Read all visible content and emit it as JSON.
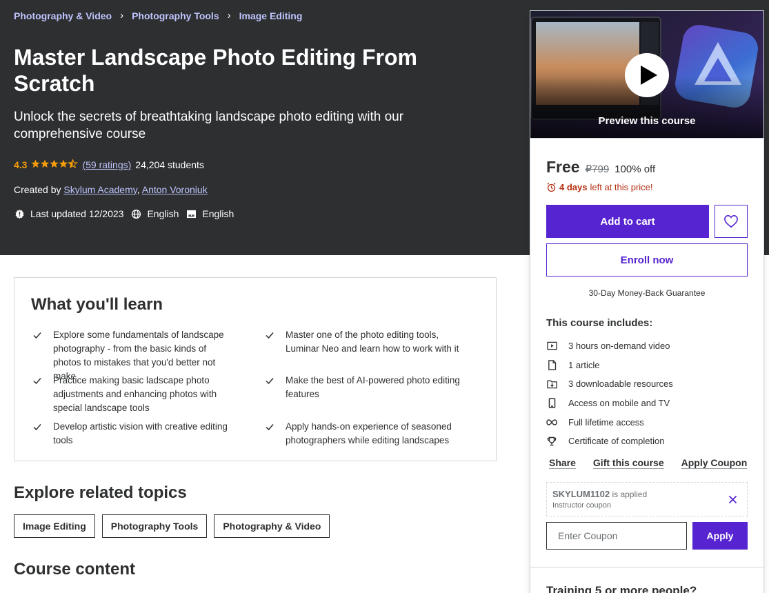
{
  "breadcrumb": [
    {
      "label": "Photography & Video"
    },
    {
      "label": "Photography Tools"
    },
    {
      "label": "Image Editing"
    }
  ],
  "course": {
    "title": "Master Landscape Photo Editing From Scratch",
    "subtitle": "Unlock the secrets of breathtaking landscape photo editing with our comprehensive course",
    "rating": "4.3",
    "rating_stars": 4.3,
    "ratings_link": "(59 ratings)",
    "students": "24,204 students",
    "created_by_label": "Created by",
    "instructors": [
      "Skylum Academy",
      "Anton Voroniuk"
    ],
    "last_updated": "Last updated 12/2023",
    "language": "English",
    "captions": "English"
  },
  "sidebar": {
    "preview_label": "Preview this course",
    "price_current": "Free",
    "price_original": "₽799",
    "discount": "100% off",
    "timer_bold": "4 days",
    "timer_rest": "left at this price!",
    "add_to_cart": "Add to cart",
    "enroll": "Enroll now",
    "guarantee": "30-Day Money-Back Guarantee",
    "includes_title": "This course includes:",
    "includes": [
      {
        "icon": "video-icon",
        "label": "3 hours on-demand video"
      },
      {
        "icon": "article-icon",
        "label": "1 article"
      },
      {
        "icon": "download-icon",
        "label": "3 downloadable resources"
      },
      {
        "icon": "mobile-icon",
        "label": "Access on mobile and TV"
      },
      {
        "icon": "infinity-icon",
        "label": "Full lifetime access"
      },
      {
        "icon": "trophy-icon",
        "label": "Certificate of completion"
      }
    ],
    "links": [
      "Share",
      "Gift this course",
      "Apply Coupon"
    ],
    "coupon_code": "SKYLUM1102",
    "coupon_applied": "is applied",
    "coupon_type": "Instructor coupon",
    "coupon_placeholder": "Enter Coupon",
    "apply": "Apply",
    "training_title": "Training 5 or more people?"
  },
  "learn": {
    "title": "What you'll learn",
    "items": [
      "Explore some fundamentals of landscape photography - from the basic kinds of photos to mistakes that you'd better not make",
      "Master one of the photo editing tools, Luminar Neo and learn how to work with it",
      "Practice making basic ladscape photo adjustments and enhancing photos with special landscape tools",
      "Make the best of AI-powered photo editing features",
      "Develop artistic vision with creative editing tools",
      "Apply hands-on experience of seasoned photographers while editing landscapes"
    ]
  },
  "topics": {
    "title": "Explore related topics",
    "chips": [
      "Image Editing",
      "Photography Tools",
      "Photography & Video"
    ]
  },
  "course_content": {
    "title": "Course content"
  },
  "colors": {
    "hero_bg": "#2d2f31",
    "accent_purple": "#5624d0",
    "link_lavender": "#c0c4fc",
    "star_orange": "#f69c08",
    "timer_red": "#b32d0f"
  }
}
